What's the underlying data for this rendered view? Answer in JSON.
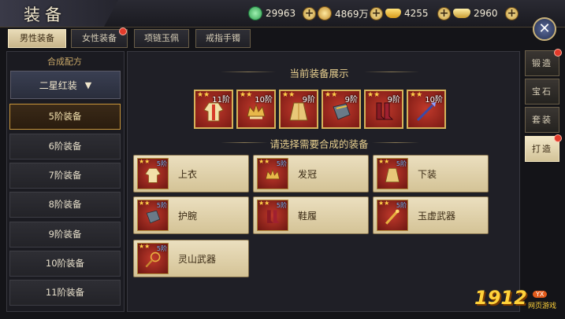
{
  "header": {
    "title": "装备",
    "currencies": [
      {
        "icon": "jade-coin-icon",
        "value": "29963",
        "color": "#3fbf5f"
      },
      {
        "icon": "copper-coin-icon",
        "value": "4869万",
        "color": "#e0b64a"
      },
      {
        "icon": "gold-ingot-icon",
        "value": "4255",
        "color": "#f2c440"
      },
      {
        "icon": "silver-ingot-icon",
        "value": "2960",
        "color": "#e8c86a"
      }
    ]
  },
  "tabs": [
    {
      "label": "男性装备",
      "active": true,
      "badge": false
    },
    {
      "label": "女性装备",
      "active": false,
      "badge": true
    },
    {
      "label": "项链玉佩",
      "active": false,
      "badge": false
    },
    {
      "label": "戒指手镯",
      "active": false,
      "badge": false
    }
  ],
  "sidebar": {
    "recipe_label": "合成配方",
    "dropdown_value": "二星红装",
    "dropdown_arrow": "▼",
    "levels": [
      "5阶装备",
      "6阶装备",
      "7阶装备",
      "8阶装备",
      "9阶装备",
      "10阶装备",
      "11阶装备"
    ],
    "active_level": 0
  },
  "main": {
    "current_title": "当前装备展示",
    "select_title": "请选择需要合成的装备",
    "equipped": [
      {
        "tier": "11阶",
        "icon": "robe-icon",
        "stars": "★★"
      },
      {
        "tier": "10阶",
        "icon": "crown-icon",
        "stars": "★★"
      },
      {
        "tier": "9阶",
        "icon": "skirt-armor-icon",
        "stars": "★★"
      },
      {
        "tier": "9阶",
        "icon": "bracer-icon",
        "stars": "★★"
      },
      {
        "tier": "9阶",
        "icon": "boots-icon",
        "stars": "★★"
      },
      {
        "tier": "10阶",
        "icon": "spear-icon",
        "stars": "★★"
      }
    ],
    "options": [
      {
        "name": "上衣",
        "tier": "5阶",
        "icon": "robe-icon",
        "stars": "★★"
      },
      {
        "name": "发冠",
        "tier": "5阶",
        "icon": "crown-icon",
        "stars": "★★"
      },
      {
        "name": "下装",
        "tier": "5阶",
        "icon": "skirt-armor-icon",
        "stars": "★★"
      },
      {
        "name": "护腕",
        "tier": "5阶",
        "icon": "bracer-icon",
        "stars": "★★"
      },
      {
        "name": "鞋履",
        "tier": "5阶",
        "icon": "boots-icon",
        "stars": "★★"
      },
      {
        "name": "玉虚武器",
        "tier": "5阶",
        "icon": "staff-icon",
        "stars": "★★"
      },
      {
        "name": "灵山武器",
        "tier": "5阶",
        "icon": "racket-weapon-icon",
        "stars": "★★"
      }
    ]
  },
  "side_tabs": [
    {
      "label": "锻造",
      "active": false,
      "badge": true
    },
    {
      "label": "宝石",
      "active": false,
      "badge": false
    },
    {
      "label": "套装",
      "active": false,
      "badge": false
    },
    {
      "label": "打造",
      "active": true,
      "badge": true
    }
  ],
  "close_label": "✕",
  "watermark": {
    "main": "1912",
    "badge": "YX",
    "site": "网页游戏"
  }
}
